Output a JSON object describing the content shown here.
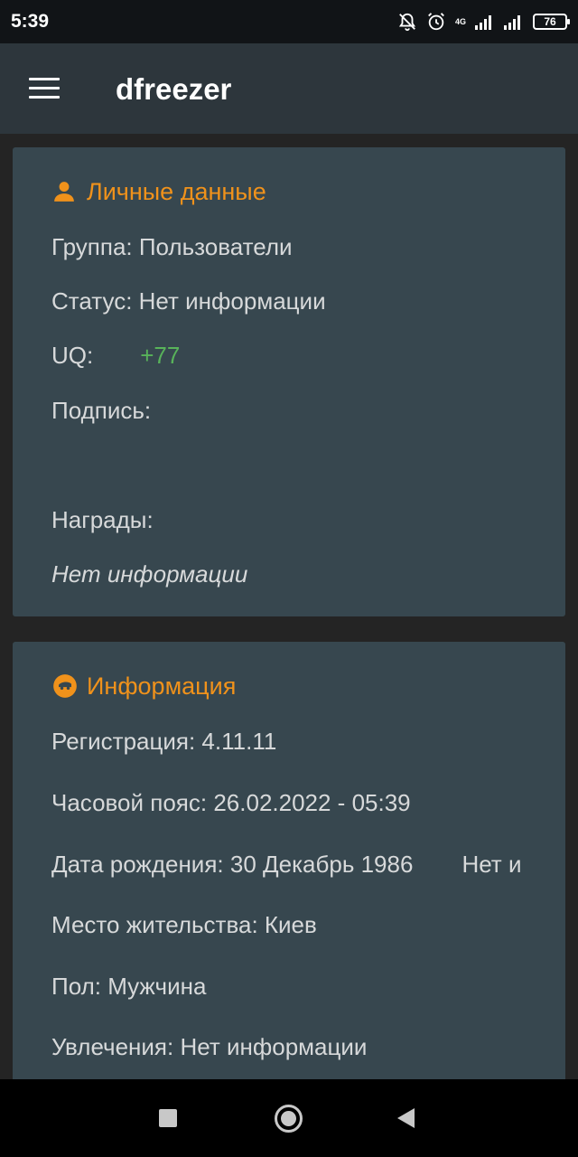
{
  "status_bar": {
    "time": "5:39",
    "network": "4G",
    "battery": "76"
  },
  "app_bar": {
    "title": "dfreezer",
    "menu_icon": "hamburger-menu-icon"
  },
  "personal_card": {
    "title": "Личные данные",
    "icon": "person-icon",
    "group": "Группа: Пользователи",
    "status": "Статус: Нет информации",
    "uq_label": "UQ:",
    "uq_value": "+77",
    "signature": "Подпись:",
    "awards_label": "Награды:",
    "awards_value": "Нет информации"
  },
  "info_card": {
    "title": "Информация",
    "icon": "face-icon",
    "registration": "Регистрация: 4.11.11",
    "timezone": "Часовой пояс: 26.02.2022 - 05:39",
    "birthday": "Дата рождения: 30 Декабрь 1986",
    "birthday_overflow": "Нет и",
    "residence": "Место жительства: Киев",
    "gender": "Пол: Мужчина",
    "hobbies": "Увлечения: Нет информации"
  },
  "colors": {
    "accent": "#f0921b",
    "card_bg": "#37474f",
    "app_bar_bg": "#2d363c",
    "positive": "#58b35a"
  }
}
